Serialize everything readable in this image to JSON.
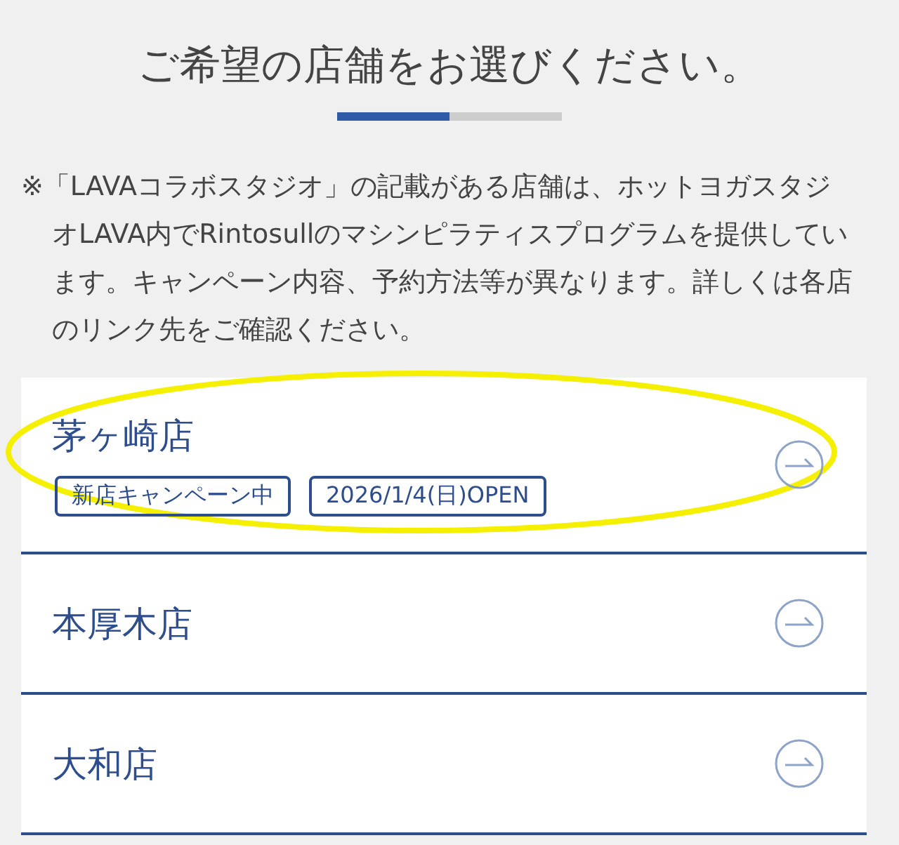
{
  "title": "ご希望の店舗をお選びください。",
  "progress": {
    "level": 0.5
  },
  "note": "※「LAVAコラボスタジオ」の記載がある店舗は、ホットヨガスタジオLAVA内でRintosullのマシンピラティスプログラムを提供しています。キャンペーン内容、予約方法等が異なります。詳しくは各店のリンク先をご確認ください。",
  "stores": [
    {
      "name": "茅ヶ崎店",
      "tags": [
        "新店キャンペーン中",
        "2026/1/4(日)OPEN"
      ]
    },
    {
      "name": "本厚木店"
    },
    {
      "name": "大和店"
    }
  ]
}
